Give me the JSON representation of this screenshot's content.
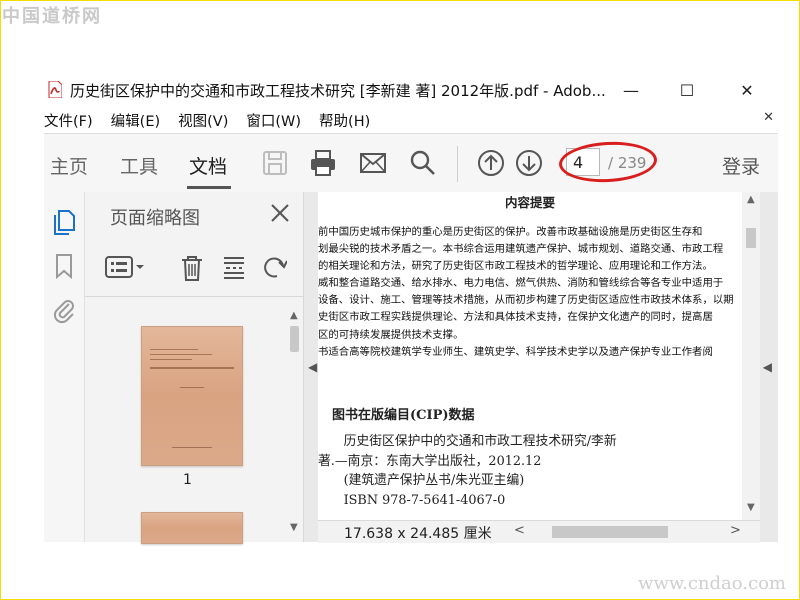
{
  "watermark": {
    "top": "中国道桥网",
    "bottom": "www.cndao.com"
  },
  "window": {
    "title": "历史街区保护中的交通和市政工程技术研究 [李新建 著] 2012年版.pdf - Adob...",
    "buttons": {
      "minimize": "—",
      "maximize": "☐",
      "close": "✕"
    }
  },
  "menu": {
    "items": [
      "文件(F)",
      "编辑(E)",
      "视图(V)",
      "窗口(W)",
      "帮助(H)"
    ],
    "close": "✕"
  },
  "toolbar": {
    "tabs": [
      "主页",
      "工具",
      "文档"
    ],
    "active_tab": "文档",
    "current_page": "4",
    "total_pages": "/ 239",
    "login": "登录"
  },
  "sidebar": {
    "title": "页面缩略图"
  },
  "thumbnails": {
    "page_label": "1"
  },
  "document": {
    "heading": "内容提要",
    "summary_lines": [
      "前中国历史城市保护的重心是历史街区的保护。改善市政基础设施是历史街区生存和",
      "划最尖锐的技术矛盾之一。本书综合运用建筑遗产保护、城市规划、道路交通、市政工程",
      "的相关理论和方法，研究了历史街区市政工程技术的哲学理论、应用理论和工作方法。",
      "威和整合道路交通、给水排水、电力电信、燃气供热、消防和管线综合等各专业中适用于",
      "设备、设计、施工、管理等技术措施，从而初步构建了历史街区适应性市政技术体系，以期",
      "史街区市政工程实践提供理论、方法和具体技术支持，在保护文化遗产的同时，提高居",
      "区的可持续发展提供技术支撑。",
      "书适合高等院校建筑学专业师生、建筑史学、科学技术史学以及遗产保护专业工作者阅"
    ],
    "cip_heading": "图书在版编目(CIP)数据",
    "cip_lines": [
      "　　历史街区保护中的交通和市政工程技术研究/李新",
      "著.—南京：东南大学出版社，2012.12",
      "　　(建筑遗产保护丛书/朱光亚主编)",
      "　　ISBN 978-7-5641-4067-0"
    ],
    "page_size": "17.638 x 24.485 厘米"
  },
  "colors": {
    "accent_blue": "#1a73c8",
    "annotation_red": "#d91e1e",
    "watermark_green": "#2f9a2f"
  }
}
